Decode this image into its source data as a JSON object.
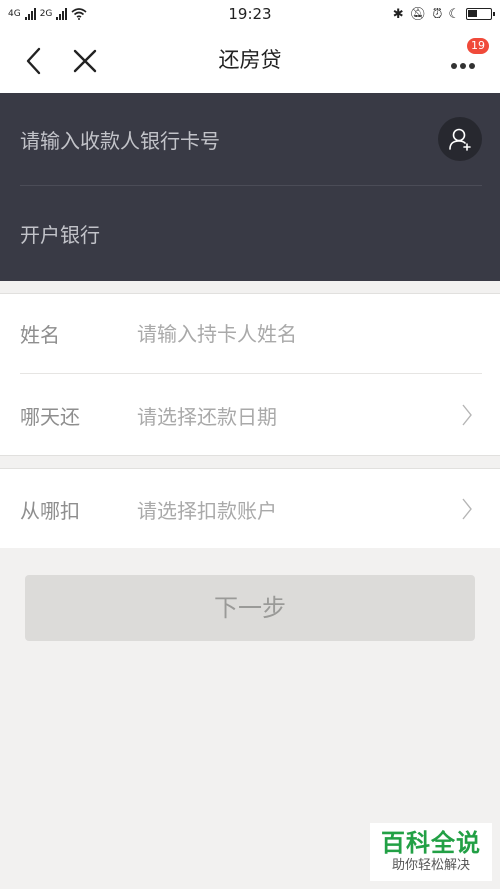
{
  "status_bar": {
    "network_left": "4G",
    "network_right": "2G",
    "time": "19:23"
  },
  "nav": {
    "title": "还房贷",
    "badge_count": "19",
    "icons": [
      "back-arrow-icon",
      "close-icon",
      "more-dots-icon"
    ]
  },
  "dark_section": {
    "card_number_placeholder": "请输入收款人银行卡号",
    "bank_label": "开户银行",
    "icons": [
      "contact-add-icon"
    ]
  },
  "form": {
    "name": {
      "label": "姓名",
      "placeholder": "请输入持卡人姓名"
    },
    "date": {
      "label": "哪天还",
      "value": "请选择还款日期"
    },
    "account": {
      "label": "从哪扣",
      "value": "请选择扣款账户"
    }
  },
  "next_button": {
    "label": "下一步"
  },
  "watermark": {
    "main": "百科全说",
    "sub": "助你轻松解决"
  },
  "colors": {
    "dark_section_bg": "#393a45",
    "page_bg": "#f2f1f0",
    "badge": "#f04a3a",
    "watermark_green": "#22a045"
  }
}
